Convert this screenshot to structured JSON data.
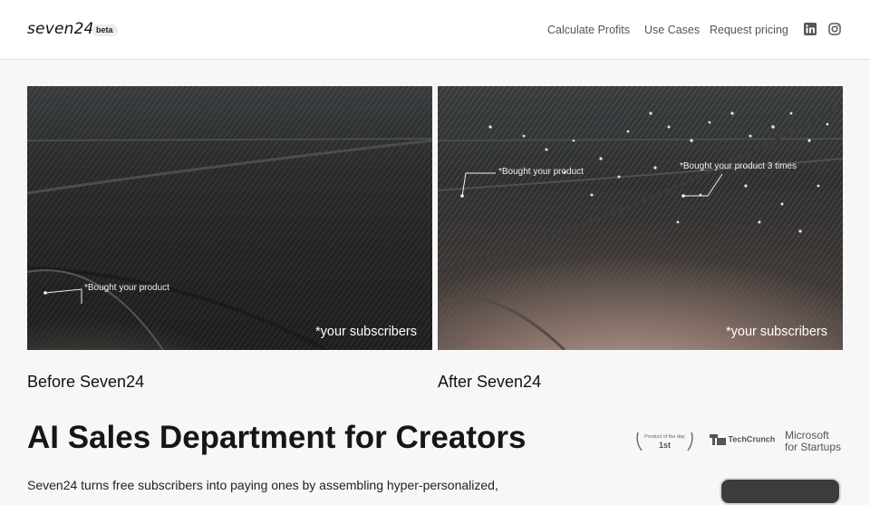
{
  "header": {
    "logo": "seven24",
    "badge": "beta",
    "nav": [
      "Calculate Profits",
      "Use Cases",
      "Request pricing"
    ],
    "social_icons": [
      "linkedin-icon",
      "instagram-icon"
    ]
  },
  "comparison": {
    "before": {
      "annotation": "*Bought your product",
      "overlay": "*your subscribers",
      "caption": "Before Seven24"
    },
    "after": {
      "annotation_1": "*Bought your product",
      "annotation_2": "*Bought your product 3 times",
      "overlay": "*your subscribers",
      "caption": "After Seven24"
    }
  },
  "hero": {
    "title": "AI Sales Department for Creators",
    "description": "Seven24 turns free subscribers into paying ones by assembling hyper-personalized,"
  },
  "press": {
    "product_hunt_top": "Product of the day",
    "product_hunt_rank": "1st",
    "techcrunch": "TechCrunch",
    "microsoft_line1": "Microsoft",
    "microsoft_line2": "for Startups"
  },
  "colors": {
    "header_bg": "#ffffff",
    "page_bg": "#f7f7f7",
    "cta_bg": "#3c3c3c"
  }
}
